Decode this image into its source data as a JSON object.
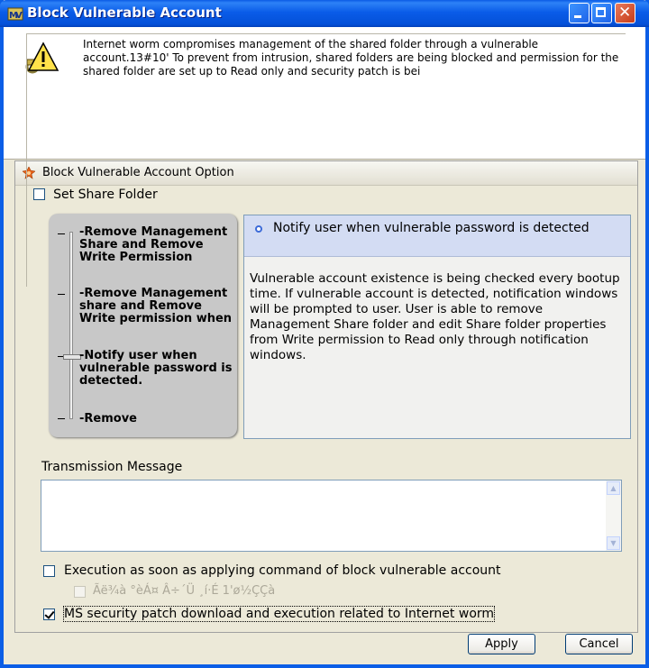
{
  "window": {
    "title": "Block Vulnerable Account"
  },
  "warning": {
    "icon": "warning-keyring-icon",
    "text": "Internet worm compromises management of the shared folder through a vulnerable account.13#10' To prevent from intrusion, shared folders are being blocked and permission for the shared folder are set up to Read only and security patch is bei"
  },
  "option_group": {
    "title": "Block Vulnerable Account Option",
    "icon": "orange-gear-icon"
  },
  "set_share_folder": {
    "label": "Set Share Folder",
    "checked": false
  },
  "slider": {
    "levels": [
      "-Remove Management Share and Remove Write Permission",
      "-Remove Management share and Remove Write permission when",
      "-Notify user when vulnerable password is detected.",
      "-Remove"
    ],
    "selected_index": 2
  },
  "detail": {
    "header": "Notify user when vulnerable password is detected",
    "body": "Vulnerable account existence is being checked every bootup time. If vulnerable account is detected, notification windows will be prompted to user. User is able to remove Management Share folder and edit Share folder properties from Write permission to Read only through notification windows."
  },
  "transmission": {
    "label": "Transmission Message",
    "value": ""
  },
  "options": {
    "execution_label": "Execution as soon as applying command of block vulnerable account",
    "execution_checked": false,
    "garbled_label": "Ãë¾à °èÁ¤ Â÷´Ü ¸í·É 1'ø½ÇÇà",
    "garbled_checked": false,
    "patch_label": "MS security patch download and execution related to Internet worm",
    "patch_checked": true
  },
  "buttons": {
    "apply": "Apply",
    "cancel": "Cancel"
  }
}
